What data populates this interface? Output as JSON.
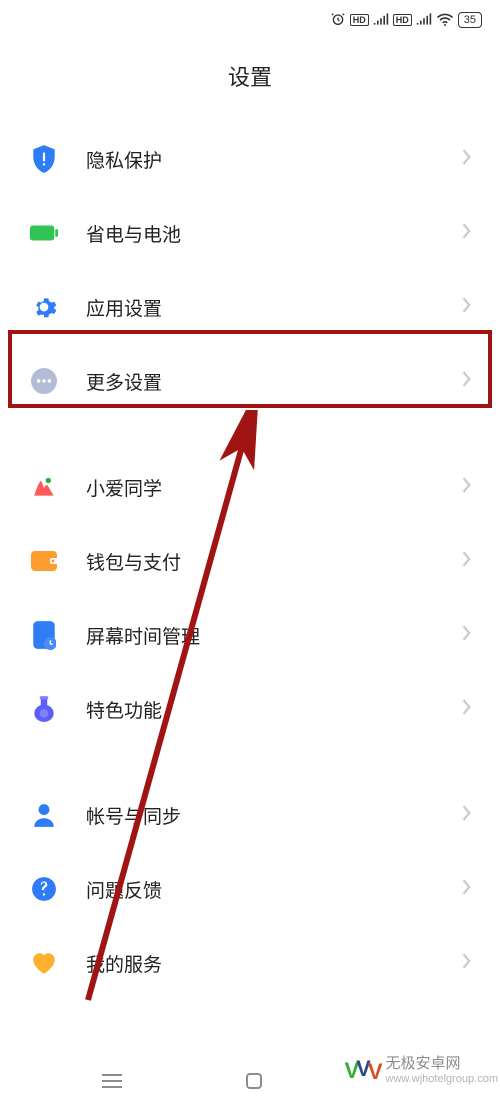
{
  "status": {
    "battery": "35"
  },
  "page": {
    "title": "设置"
  },
  "groups": [
    {
      "items": [
        {
          "id": "privacy",
          "label": "隐私保护",
          "icon": "shield-icon",
          "color": "#2e7cf6"
        },
        {
          "id": "battery",
          "label": "省电与电池",
          "icon": "battery-filled-icon",
          "color": "#31c453"
        },
        {
          "id": "apps",
          "label": "应用设置",
          "icon": "gear-icon",
          "color": "#2e7cf6"
        },
        {
          "id": "more",
          "label": "更多设置",
          "icon": "dots-icon",
          "color": "#9aa3c9"
        }
      ]
    },
    {
      "items": [
        {
          "id": "xiaoai",
          "label": "小爱同学",
          "icon": "xiaoai-icon",
          "color": "#ff5a5a"
        },
        {
          "id": "wallet",
          "label": "钱包与支付",
          "icon": "wallet-icon",
          "color": "#ff9c2e"
        },
        {
          "id": "screen-time",
          "label": "屏幕时间管理",
          "icon": "screentime-icon",
          "color": "#2e7cf6"
        },
        {
          "id": "features",
          "label": "特色功能",
          "icon": "flask-icon",
          "color": "#5e5efb"
        }
      ]
    },
    {
      "items": [
        {
          "id": "account",
          "label": "帐号与同步",
          "icon": "account-icon",
          "color": "#2e7cf6"
        },
        {
          "id": "feedback",
          "label": "问题反馈",
          "icon": "help-icon",
          "color": "#2e7cf6"
        },
        {
          "id": "service",
          "label": "我的服务",
          "icon": "heart-icon",
          "color": "#ffb02e"
        }
      ]
    }
  ],
  "watermark": {
    "cn": "无极安卓网",
    "url": "www.wjhotelgroup.com"
  }
}
